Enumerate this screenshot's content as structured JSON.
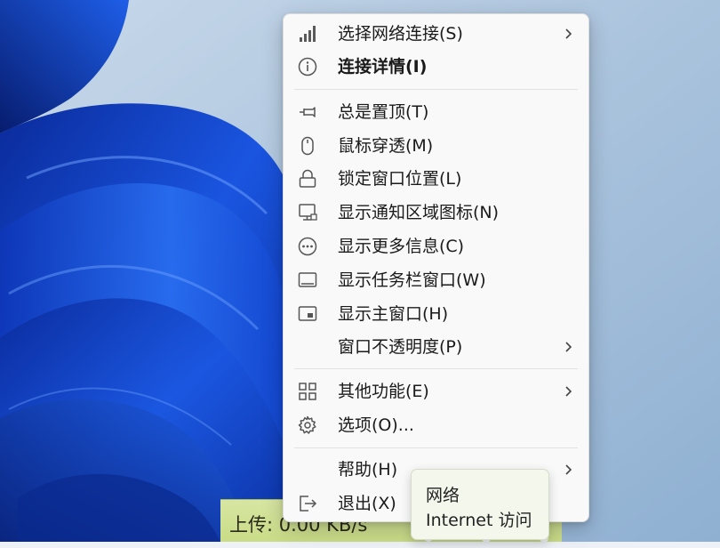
{
  "taskbar": {
    "speed_text": "上传: 0.00 KB/s"
  },
  "menu": {
    "items": [
      {
        "label": "选择网络连接(S)",
        "icon": "signal-bars-icon",
        "submenu": true
      },
      {
        "label": "连接详情(I)",
        "icon": "info-icon",
        "submenu": false,
        "bold": true
      },
      {
        "label": "总是置顶(T)",
        "icon": "pin-icon",
        "submenu": false
      },
      {
        "label": "鼠标穿透(M)",
        "icon": "mouse-icon",
        "submenu": false
      },
      {
        "label": "锁定窗口位置(L)",
        "icon": "lock-icon",
        "submenu": false
      },
      {
        "label": "显示通知区域图标(N)",
        "icon": "monitor-tray-icon",
        "submenu": false
      },
      {
        "label": "显示更多信息(C)",
        "icon": "more-dots-icon",
        "submenu": false
      },
      {
        "label": "显示任务栏窗口(W)",
        "icon": "taskbar-window-icon",
        "submenu": false
      },
      {
        "label": "显示主窗口(H)",
        "icon": "main-window-icon",
        "submenu": false
      },
      {
        "label": "窗口不透明度(P)",
        "icon": "",
        "submenu": true
      },
      {
        "label": "其他功能(E)",
        "icon": "grid-apps-icon",
        "submenu": true
      },
      {
        "label": "选项(O)...",
        "icon": "gear-icon",
        "submenu": false
      },
      {
        "label": "帮助(H)",
        "icon": "",
        "submenu": true
      },
      {
        "label": "退出(X)",
        "icon": "exit-icon",
        "submenu": false
      }
    ]
  },
  "tooltip": {
    "line1": "网络",
    "line2": "Internet 访问"
  },
  "colors": {
    "menu_bg": "#f9f9f9",
    "wallpaper_blue": "#1240c8",
    "taskbar_green": "#d7e6a2",
    "tooltip_bg": "#f4f7ec"
  }
}
